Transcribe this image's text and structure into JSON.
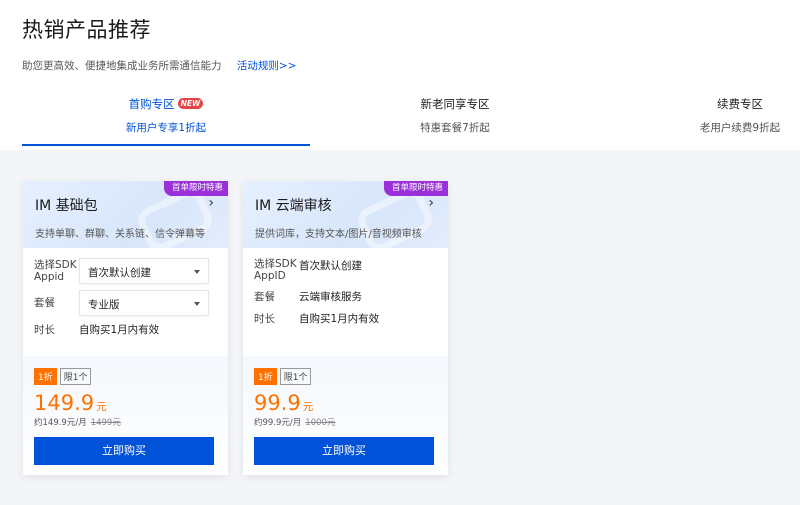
{
  "header": {
    "title": "热销产品推荐",
    "subtitle": "助您更高效、便捷地集成业务所需通信能力",
    "rules_link": "活动规则>>"
  },
  "tabs": [
    {
      "label": "首购专区",
      "badge": "NEW",
      "sub": "新用户专享1折起"
    },
    {
      "label": "新老同享专区",
      "sub": "特惠套餐7折起"
    },
    {
      "label": "续费专区",
      "sub": "老用户续费9折起"
    }
  ],
  "colors": {
    "accent": "#0052d9",
    "price": "#ff7200",
    "promo_tag": "#9b30d9",
    "new_badge": "#e54545"
  },
  "cards": [
    {
      "promo_tag": "首单限时特惠",
      "name": "IM 基础包",
      "desc": "支持单聊、群聊、关系链、信令弹幕等",
      "sdk_label": "选择SDK Appid",
      "sdk_value": "首次默认创建",
      "plan_label": "套餐",
      "plan_value": "专业版",
      "duration_label": "时长",
      "duration_value": "自购买1月内有效",
      "discount_badge": "1折",
      "limit_badge": "限1个",
      "price": "149.9",
      "price_unit": "元",
      "price_note": "约149.9元/月",
      "original_price": "1499元",
      "buy_label": "立即购买"
    },
    {
      "promo_tag": "首单限时特惠",
      "name": "IM 云端审核",
      "desc": "提供词库，支持文本/图片/音视频审核",
      "sdk_label": "选择SDK AppID",
      "sdk_value": "首次默认创建",
      "plan_label": "套餐",
      "plan_value": "云端审核服务",
      "duration_label": "时长",
      "duration_value": "自购买1月内有效",
      "discount_badge": "1折",
      "limit_badge": "限1个",
      "price": "99.9",
      "price_unit": "元",
      "price_note": "约99.9元/月",
      "original_price": "1000元",
      "buy_label": "立即购买"
    }
  ]
}
